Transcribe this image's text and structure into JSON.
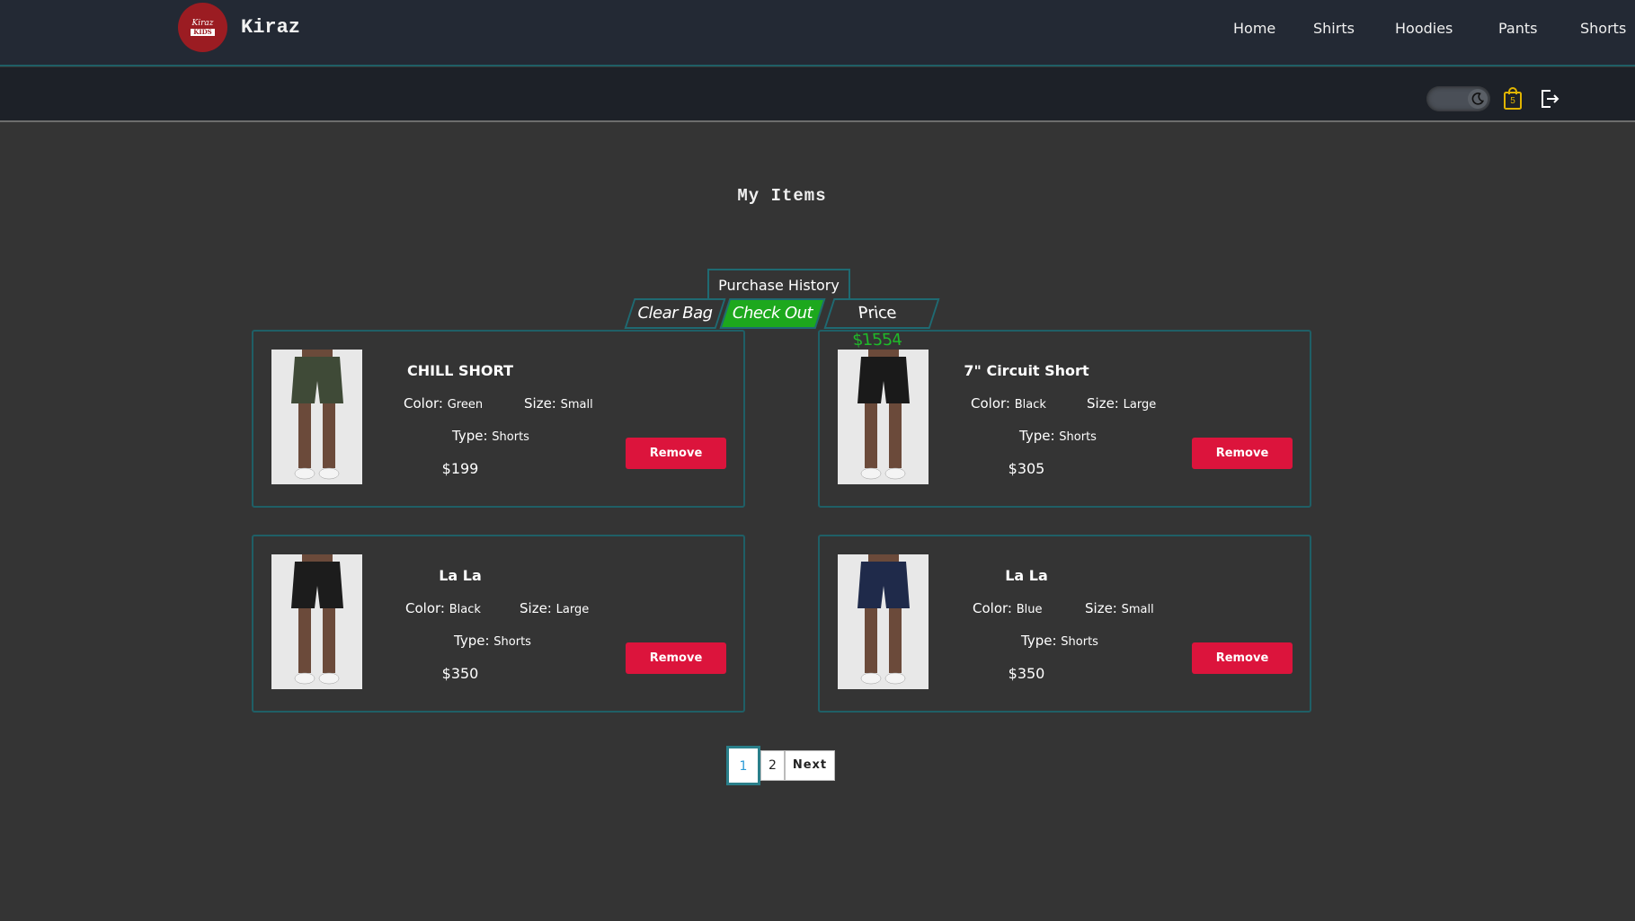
{
  "brand": {
    "name": "Kiraz",
    "logo_text": {
      "l1": "Kiraz",
      "l2": "KIDS"
    }
  },
  "nav": [
    "Home",
    "Shirts",
    "Hoodies",
    "Pants",
    "Shorts"
  ],
  "toolbar": {
    "theme_toggle_icon": "moon-icon",
    "bag_count": "5",
    "bag_icon": "shopping-bag-icon",
    "logout_icon": "logout-icon"
  },
  "page_title": "My Items",
  "actions": {
    "purchase_history": "Purchase History",
    "clear_bag": "Clear Bag",
    "check_out": "Check Out",
    "price_label": "Price",
    "price_value": "$1554"
  },
  "labels": {
    "color": "Color:",
    "size": "Size:",
    "type": "Type:",
    "remove": "Remove"
  },
  "items": [
    {
      "name": "CHILL SHORT",
      "color": "Green",
      "size": "Small",
      "type": "Shorts",
      "price": "$199",
      "shorts_color": "#3f4a37"
    },
    {
      "name": "7\" Circuit Short",
      "color": "Black",
      "size": "Large",
      "type": "Shorts",
      "price": "$305",
      "shorts_color": "#1a1a1a"
    },
    {
      "name": "La La",
      "color": "Black",
      "size": "Large",
      "type": "Shorts",
      "price": "$350",
      "shorts_color": "#1c1c1c"
    },
    {
      "name": "La La",
      "color": "Blue",
      "size": "Small",
      "type": "Shorts",
      "price": "$350",
      "shorts_color": "#1f2a4a"
    }
  ],
  "pagination": {
    "pages": [
      "1",
      "2"
    ],
    "current": "1",
    "next": "Next"
  },
  "colors": {
    "accent": "#1f5f66",
    "remove": "#dc143c",
    "checkout": "#1da81d",
    "price": "#1fba2a"
  }
}
